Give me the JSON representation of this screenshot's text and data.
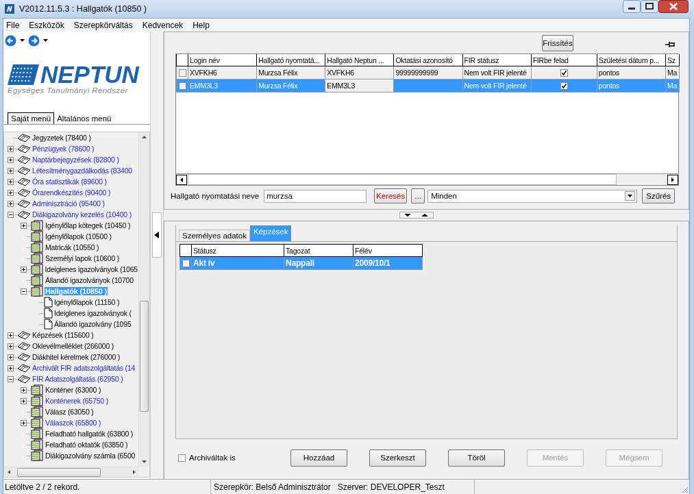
{
  "window": {
    "title": "V2012.11.5.3 : Hallgatók (10850  )"
  },
  "menu": [
    "File",
    "Eszközök",
    "Szerepkörváltás",
    "Kedvencek",
    "Help"
  ],
  "logo": {
    "name": "NEPTUN",
    "subtitle": "Egységes Tanulmányi Rendszer"
  },
  "side_tabs": [
    {
      "label": "Saját menü",
      "selected": true
    },
    {
      "label": "Általános menü",
      "selected": false
    }
  ],
  "tree": {
    "items": [
      {
        "label": "Jegyzetek (78400  )",
        "kind": "book",
        "highlighted": false
      },
      {
        "label": "Pénzügyek (78600  )",
        "kind": "book",
        "highlighted": true,
        "expanded": false
      },
      {
        "label": "Naptárbejegyzések (82800  )",
        "kind": "book",
        "highlighted": true,
        "expanded": false
      },
      {
        "label": "Létesítménygazdálkodás (83400",
        "kind": "book",
        "highlighted": true,
        "expanded": false
      },
      {
        "label": "Óra statisztikák (89600  )",
        "kind": "book",
        "highlighted": true,
        "expanded": false
      },
      {
        "label": "Órarendkészítés (90400  )",
        "kind": "book",
        "highlighted": true,
        "expanded": false
      },
      {
        "label": "Adminisztráció (95400  )",
        "kind": "book",
        "highlighted": true,
        "expanded": false
      },
      {
        "label": "Diákigazolvány kezelés (10400  )",
        "kind": "book",
        "highlighted": true,
        "expanded": true,
        "children": [
          {
            "label": "Igénylőlap kötegek (10450  )",
            "kind": "stack",
            "highlighted": false,
            "expanded": false
          },
          {
            "label": "Igénylőlapok (10500  )",
            "kind": "stack",
            "highlighted": false
          },
          {
            "label": "Matricák (10550  )",
            "kind": "stack",
            "highlighted": false
          },
          {
            "label": "Személyi lapok (10600  )",
            "kind": "stack",
            "highlighted": false
          },
          {
            "label": "Ideiglenes igazolványok (1065",
            "kind": "stack",
            "highlighted": false,
            "expanded": false
          },
          {
            "label": "Állandó igazolványok (10700",
            "kind": "stack",
            "highlighted": false
          },
          {
            "label": "Hallgatók (10850  )",
            "kind": "stack",
            "expanded": true,
            "selected": true,
            "children": [
              {
                "label": "Igénylőlapok (11150  )",
                "kind": "page",
                "highlighted": false
              },
              {
                "label": "Ideiglenes igazolványok (",
                "kind": "page",
                "highlighted": false
              },
              {
                "label": "Állandó igazolvány (1095",
                "kind": "page",
                "highlighted": false
              }
            ]
          }
        ]
      },
      {
        "label": "Képzések (115600  )",
        "kind": "book",
        "highlighted": false,
        "expanded": false
      },
      {
        "label": "Oklevélmelléklet (266000  )",
        "kind": "book",
        "highlighted": false,
        "expanded": false
      },
      {
        "label": "Diákhitel kérelmek (276000  )",
        "kind": "book",
        "highlighted": false,
        "expanded": false
      },
      {
        "label": "Archivált FIR adatszolgáltatás (14",
        "kind": "book",
        "highlighted": true,
        "expanded": false
      },
      {
        "label": "FIR Adatszolgáltatás (62950  )",
        "kind": "book",
        "highlighted": true,
        "expanded": true,
        "children": [
          {
            "label": "Konténer (63000  )",
            "kind": "stack",
            "highlighted": false,
            "expanded": false
          },
          {
            "label": "Konténerek (65750  )",
            "kind": "stack",
            "highlighted": true,
            "expanded": false
          },
          {
            "label": "Válasz (63050  )",
            "kind": "stack",
            "highlighted": false
          },
          {
            "label": "Válaszok (65800  )",
            "kind": "stack",
            "highlighted": true,
            "expanded": false
          },
          {
            "label": "Feladható hallgatók (63800  )",
            "kind": "stack",
            "highlighted": false
          },
          {
            "label": "Feladható oktatók (63850  )",
            "kind": "stack",
            "highlighted": false
          },
          {
            "label": "Diákigazolvány számla (6500",
            "kind": "stack",
            "highlighted": false
          }
        ]
      }
    ]
  },
  "refresh_button": "Frissítés",
  "table": {
    "columns": [
      "Login név",
      "Hallgató nyomtatá...",
      "Hallgató Neptun ...",
      "Oktatási azonosító",
      "FIR státusz",
      "FIRbe felad",
      "Születési dátum p...",
      "Sz"
    ],
    "rows": [
      {
        "selected": false,
        "checked": false,
        "cells": [
          {
            "kind": "text",
            "text": "XVFKH6"
          },
          {
            "kind": "text",
            "text": "Murzsa Félix"
          },
          {
            "kind": "text",
            "text": "XVFKH6"
          },
          {
            "kind": "text",
            "text": "99999999999"
          },
          {
            "kind": "text",
            "text": "Nem volt FIR jelenté"
          },
          {
            "kind": "check",
            "checked": true
          },
          {
            "kind": "text",
            "text": "pontos"
          },
          {
            "kind": "text",
            "text": "Ma"
          }
        ]
      },
      {
        "selected": true,
        "checked": false,
        "cells": [
          {
            "kind": "text",
            "text": "EMM3L3"
          },
          {
            "kind": "text",
            "text": "Murzsa Félix"
          },
          {
            "kind": "text",
            "text": "EMM3L3",
            "focused": true
          },
          {
            "kind": "text"
          },
          {
            "kind": "text",
            "text": "Nem volt FIR jelenté"
          },
          {
            "kind": "check",
            "checked": true
          },
          {
            "kind": "text",
            "text": "pontos"
          },
          {
            "kind": "text",
            "text": "Ma"
          }
        ]
      }
    ]
  },
  "search": {
    "label": "Hallgató nyomtatási neve",
    "value": "murzsa",
    "search_button": "Keresés",
    "more_button": "...",
    "filter": "Minden",
    "filter_button": "Szűrés"
  },
  "detail_tabs": [
    {
      "label": "Személyes adatok",
      "selected": false
    },
    {
      "label": "Képzések",
      "selected": true
    }
  ],
  "detail_table": {
    "columns": [
      "Státusz",
      "Tagozat",
      "Félév"
    ],
    "rows": [
      {
        "selected": true,
        "checked": false,
        "cells": [
          "Akt ív",
          "Nappali",
          "2009/10/1"
        ]
      }
    ]
  },
  "archived": {
    "label": "Archiváltak is",
    "checked": false
  },
  "buttons": [
    {
      "label": "Hozzáad",
      "disabled": false
    },
    {
      "label": "Szerkeszt",
      "disabled": false
    },
    {
      "label": "Töröl",
      "disabled": false
    },
    {
      "label": "Mentés",
      "disabled": true
    },
    {
      "label": "Mégsem",
      "disabled": true
    }
  ],
  "status_bar": [
    "Letöltve 2 / 2 rekord.",
    "Szerepkör: Belső Adminisztrátor   Szerver: DEVELOPER_Teszt"
  ]
}
